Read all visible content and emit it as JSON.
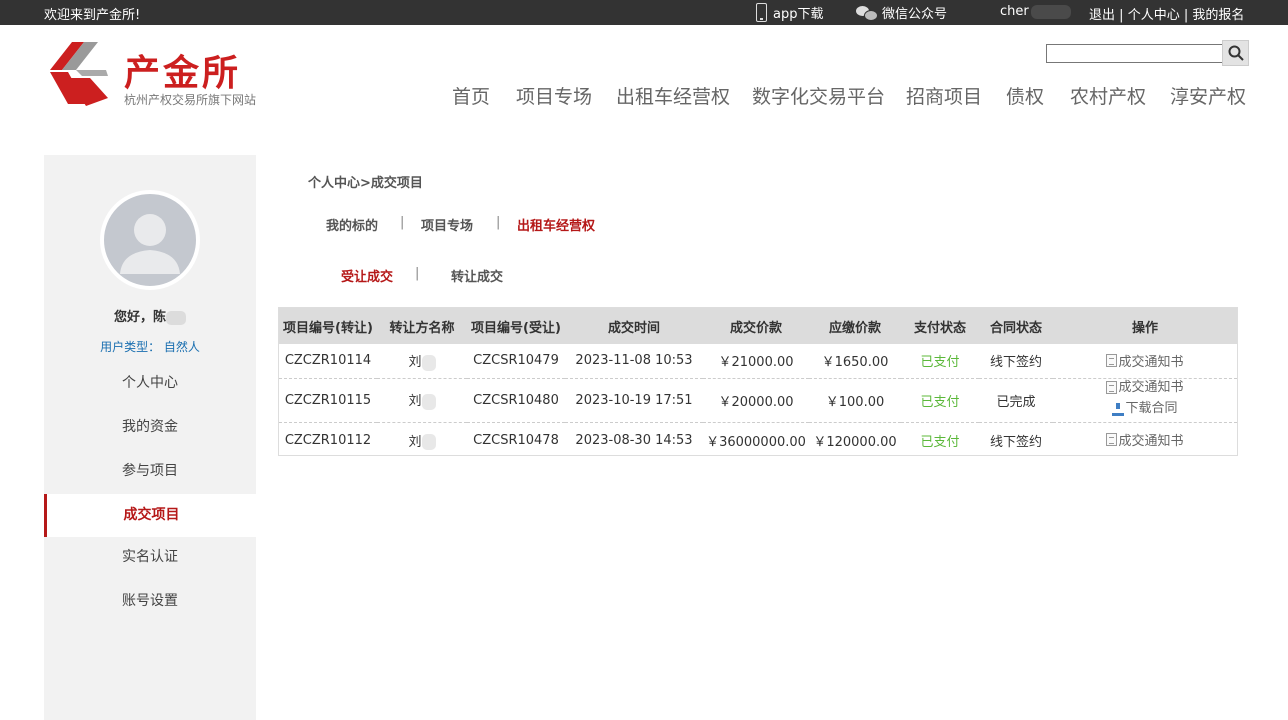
{
  "topbar": {
    "welcome": "欢迎来到产金所!",
    "app_label": "app下载",
    "wechat_label": "微信公众号",
    "username": "cher",
    "logout": "退出",
    "divider": "|",
    "personal_center": "个人中心",
    "my_signup": "我的报名"
  },
  "logo": {
    "title": "产金所",
    "subtitle": "杭州产权交易所旗下网站",
    "brand_color": "#cc1f1f"
  },
  "search": {
    "value": "",
    "icon": "search-icon"
  },
  "nav": [
    "首页",
    "项目专场",
    "出租车经营权",
    "数字化交易平台",
    "招商项目",
    "债权",
    "农村产权",
    "淳安产权"
  ],
  "sidebar": {
    "greeting": "您好，陈",
    "user_type": "用户类型：  自然人",
    "items": [
      "个人中心",
      "我的资金",
      "参与项目",
      "成交项目",
      "实名认证",
      "账号设置"
    ],
    "active": "成交项目"
  },
  "breadcrumb": "个人中心>成交项目",
  "tabs_primary": [
    "我的标的",
    "项目专场",
    "出租车经营权"
  ],
  "tabs_secondary": [
    "受让成交",
    "转让成交"
  ],
  "separator": "|",
  "table": {
    "headers": [
      "项目编号(转让)",
      "转让方名称",
      "项目编号(受让)",
      "成交时间",
      "成交价款",
      "应缴价款",
      "支付状态",
      "合同状态",
      "操作"
    ],
    "rows": [
      {
        "transfer_no": "CZCZR10114",
        "transferor": "刘",
        "receive_no": "CZCSR10479",
        "time": "2023-11-08 10:53",
        "price": "￥21000.00",
        "payable": "￥1650.00",
        "pay_status": "已支付",
        "contract_status": "线下签约",
        "actions": [
          "成交通知书"
        ]
      },
      {
        "transfer_no": "CZCZR10115",
        "transferor": "刘",
        "receive_no": "CZCSR10480",
        "time": "2023-10-19 17:51",
        "price": "￥20000.00",
        "payable": "￥100.00",
        "pay_status": "已支付",
        "contract_status": "已完成",
        "actions": [
          "成交通知书",
          "下载合同"
        ]
      },
      {
        "transfer_no": "CZCZR10112",
        "transferor": "刘",
        "receive_no": "CZCSR10478",
        "time": "2023-08-30 14:53",
        "price": "￥36000000.00",
        "payable": "￥120000.00",
        "pay_status": "已支付",
        "contract_status": "线下签约",
        "actions": [
          "成交通知书"
        ]
      }
    ]
  },
  "colors": {
    "accent": "#b51818",
    "paid": "#5cb83a",
    "link_blue": "#1a6fb0"
  }
}
